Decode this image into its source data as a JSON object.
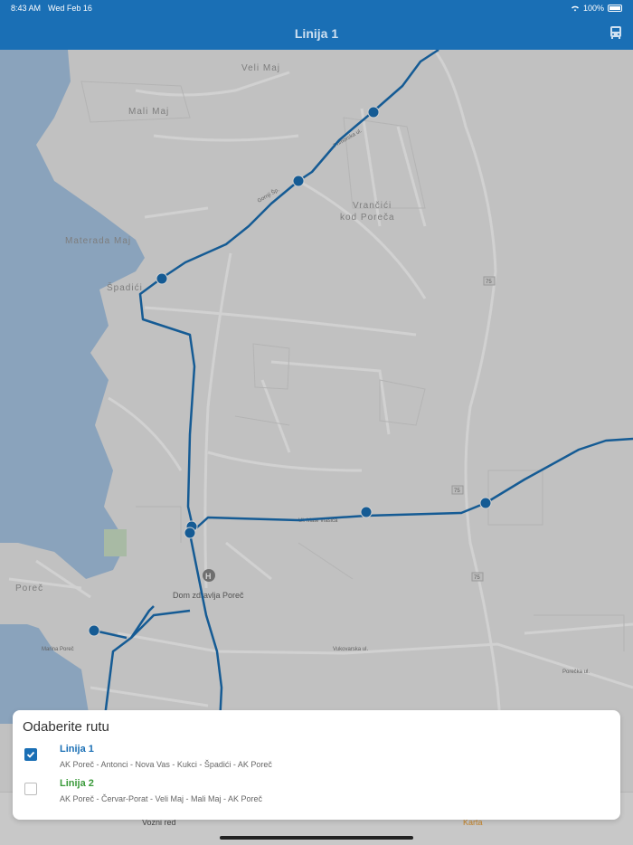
{
  "status_bar": {
    "time": "8:43 AM",
    "date": "Wed Feb 16",
    "battery": "100%"
  },
  "nav": {
    "title": "Linija 1",
    "bus_icon": "bus-icon"
  },
  "map": {
    "labels": {
      "veli_maj": "Veli Maj",
      "mali_maj": "Mali Maj",
      "materada_maj": "Materada Maj",
      "spadici": "Špadići",
      "vrnaci": "Vrančići",
      "kod_poreca": "kod Poreča",
      "porec": "Poreč",
      "dom_zdravlja": "Dom zdravlja Poreč",
      "marina_porec": "Marina Poreč",
      "vukovarska": "Vukovarska ul.",
      "porecka": "Porečka ul.",
      "primorska": "Primorska ul.",
      "gornji_sp": "Gornji Šp.",
      "mate_vlasica": "Ul. Mate Vlašića",
      "road_75": "75"
    }
  },
  "sheet": {
    "title": "Odaberite rutu",
    "routes": [
      {
        "name": "Linija 1",
        "stops": "AK Poreč - Antonci - Nova Vas - Kukci - Špadići - AK Poreč",
        "checked": true
      },
      {
        "name": "Linija 2",
        "stops": "AK Poreč - Červar-Porat - Veli Maj - Mali Maj - AK Poreč",
        "checked": false
      }
    ]
  },
  "tabs": {
    "schedule": "Vozni red",
    "map": "Karta"
  },
  "colors": {
    "primary": "#1a6fb5",
    "route2": "#3a9a3a",
    "accent": "#f0a030"
  }
}
